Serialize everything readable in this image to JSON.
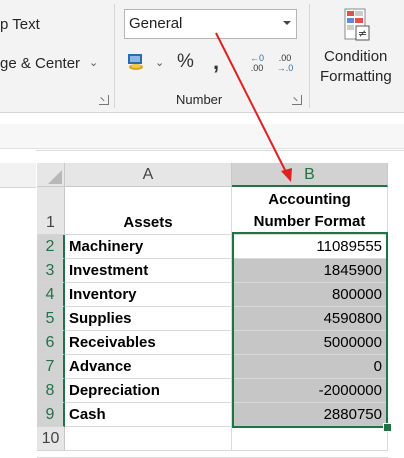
{
  "ribbon": {
    "wrap_text_label": "p Text",
    "merge_center_label": "ge & Center",
    "number_format_value": "General",
    "number_group_label": "Number",
    "percent_symbol": "%",
    "comma_symbol": ",",
    "increase_decimal_top": "←0",
    "increase_decimal_bottom": ".00",
    "decrease_decimal_top": ".00",
    "decrease_decimal_bottom": "→.0",
    "conditional_formatting_line1": "Condition",
    "conditional_formatting_line2": "Formatting"
  },
  "sheet": {
    "columns": [
      "A",
      "B"
    ],
    "rows": [
      "1",
      "2",
      "3",
      "4",
      "5",
      "6",
      "7",
      "8",
      "9",
      "10"
    ],
    "header_a": "Assets",
    "header_b_line1": "Accounting",
    "header_b_line2": "Number Format",
    "data": [
      {
        "asset": "Machinery",
        "value": "11089555"
      },
      {
        "asset": "Investment",
        "value": "1845900"
      },
      {
        "asset": "Inventory",
        "value": "800000"
      },
      {
        "asset": "Supplies",
        "value": "4590800"
      },
      {
        "asset": "Receivables",
        "value": "5000000"
      },
      {
        "asset": "Advance",
        "value": "0"
      },
      {
        "asset": "Depreciation",
        "value": "-2000000"
      },
      {
        "asset": "Cash",
        "value": "2880750"
      }
    ]
  },
  "colors": {
    "selection_border": "#217346",
    "annotation_arrow": "#e02020",
    "selected_fill": "#c6c6c6"
  }
}
